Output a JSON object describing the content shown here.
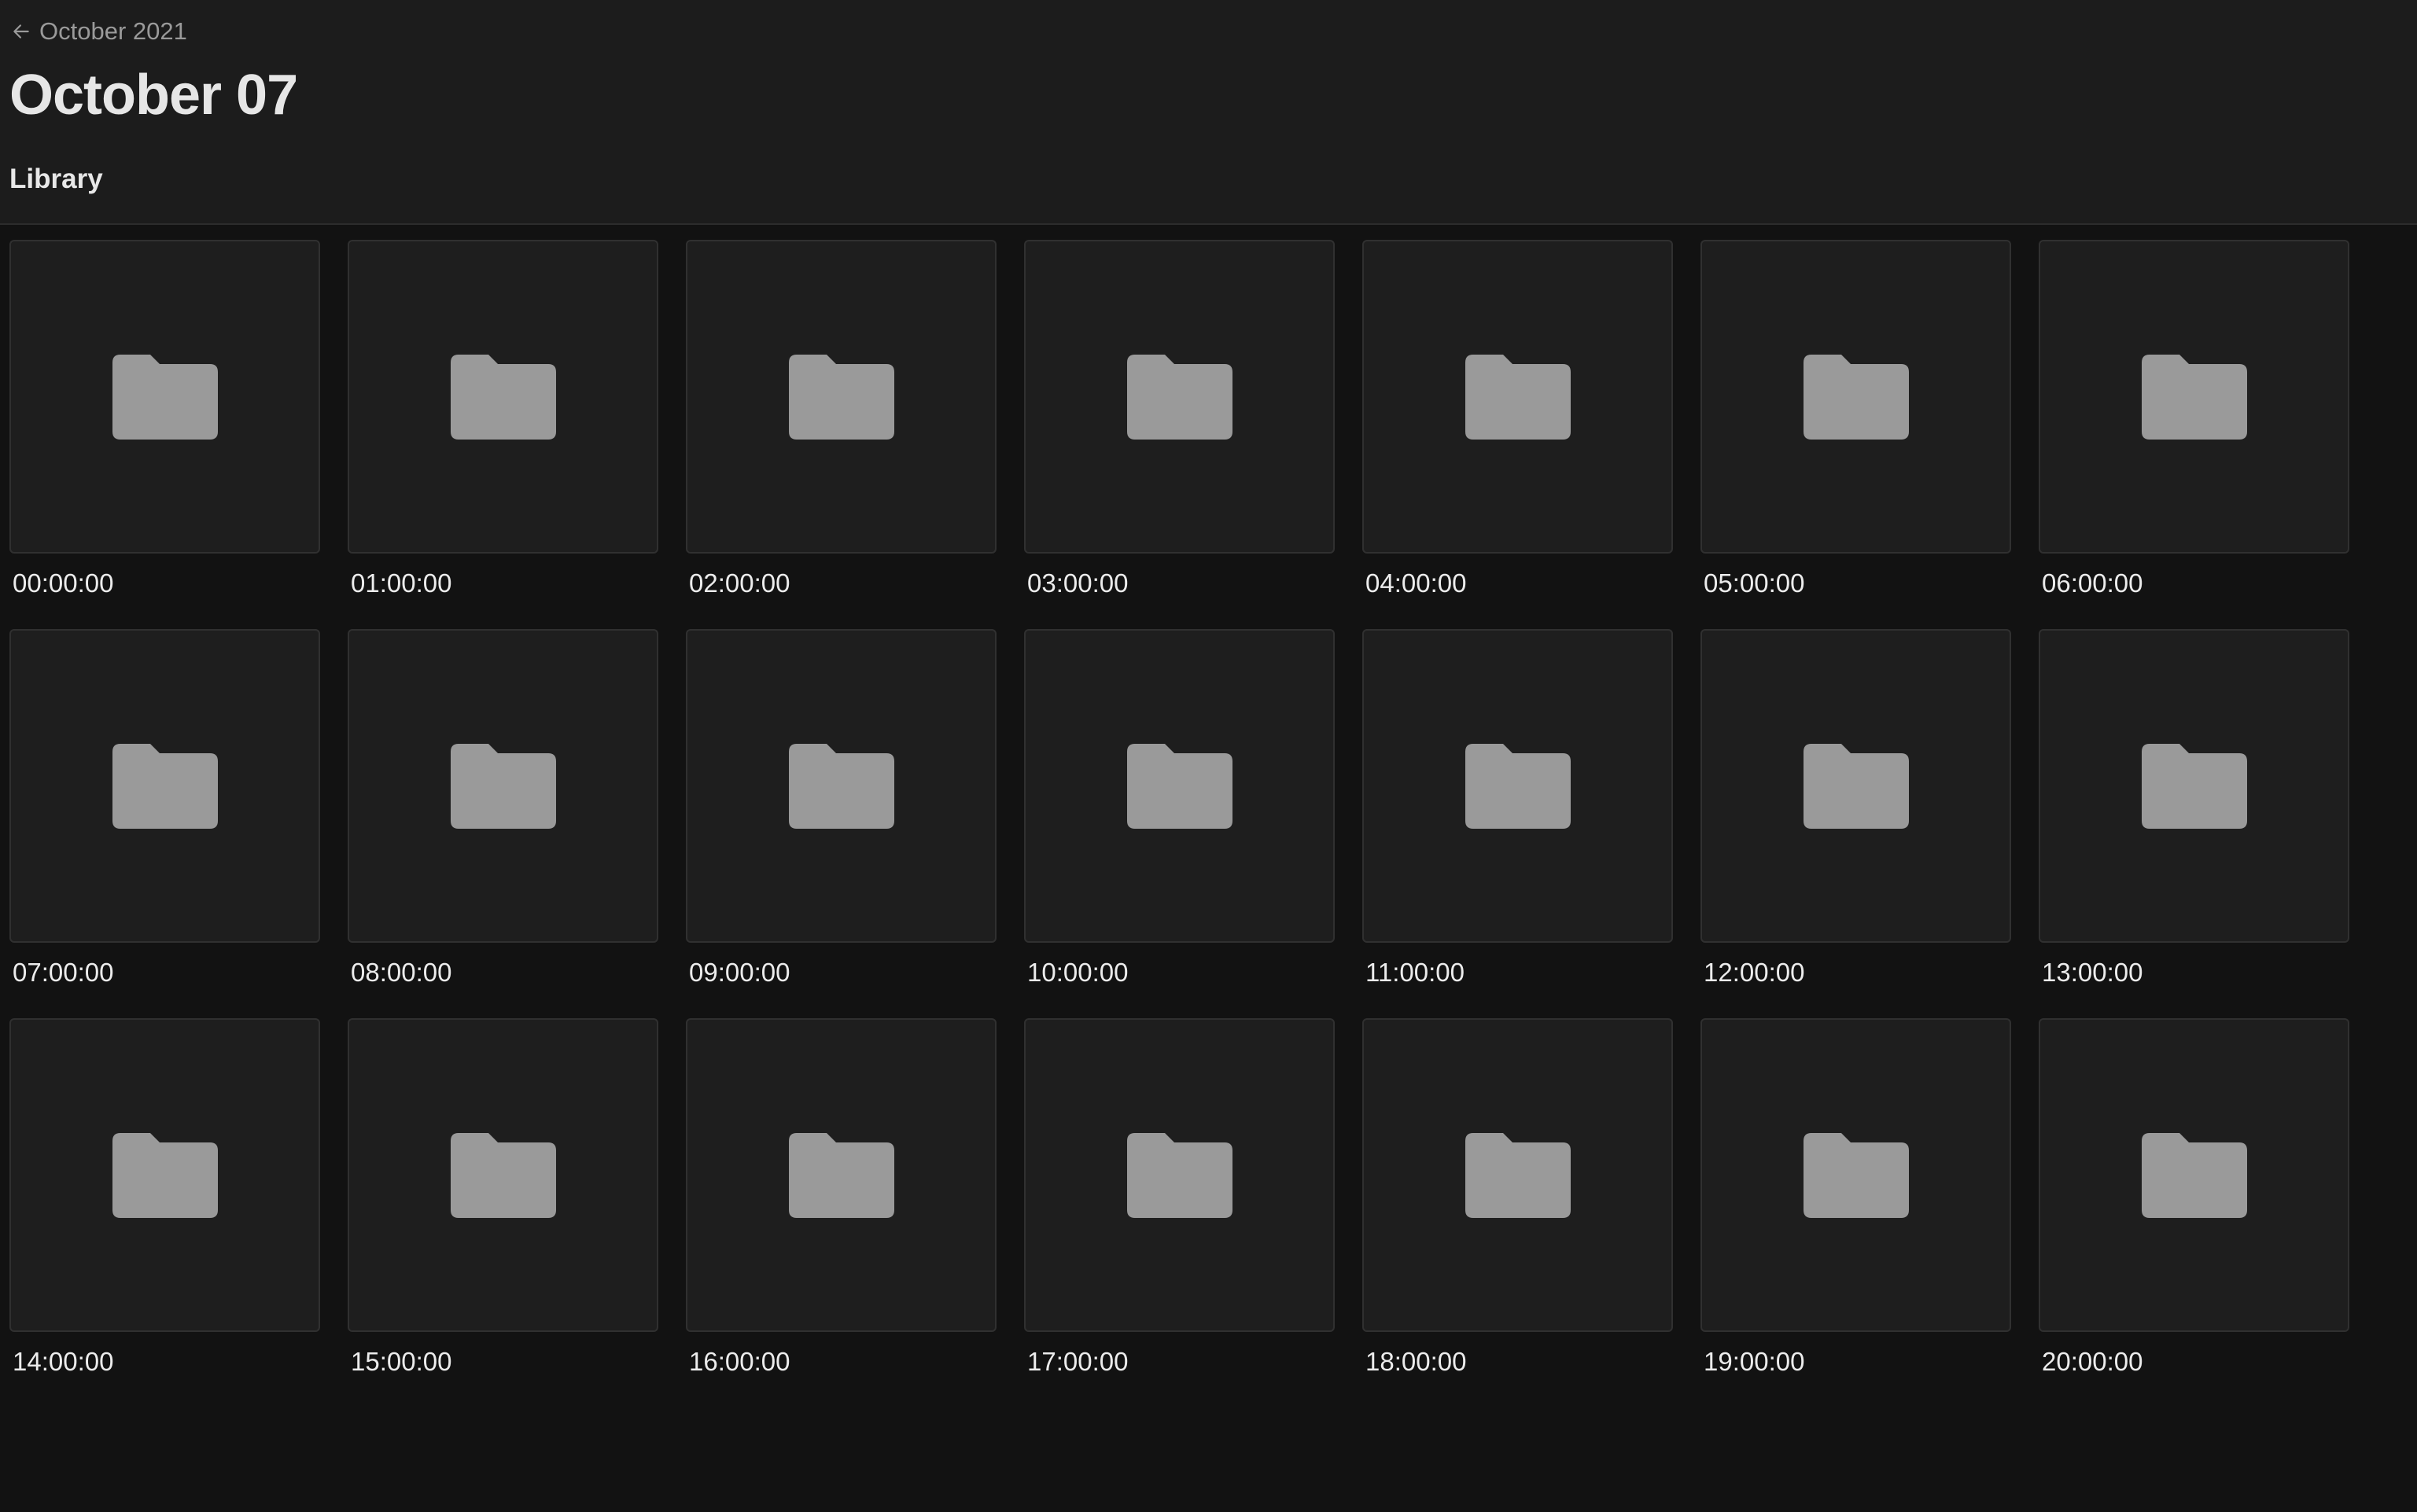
{
  "header": {
    "back_label": "October 2021",
    "title": "October 07",
    "section_tab": "Library"
  },
  "folders": [
    {
      "label": "00:00:00"
    },
    {
      "label": "01:00:00"
    },
    {
      "label": "02:00:00"
    },
    {
      "label": "03:00:00"
    },
    {
      "label": "04:00:00"
    },
    {
      "label": "05:00:00"
    },
    {
      "label": "06:00:00"
    },
    {
      "label": "07:00:00"
    },
    {
      "label": "08:00:00"
    },
    {
      "label": "09:00:00"
    },
    {
      "label": "10:00:00"
    },
    {
      "label": "11:00:00"
    },
    {
      "label": "12:00:00"
    },
    {
      "label": "13:00:00"
    },
    {
      "label": "14:00:00"
    },
    {
      "label": "15:00:00"
    },
    {
      "label": "16:00:00"
    },
    {
      "label": "17:00:00"
    },
    {
      "label": "18:00:00"
    },
    {
      "label": "19:00:00"
    },
    {
      "label": "20:00:00"
    }
  ],
  "icons": {
    "back": "arrow-left-icon",
    "folder": "folder-icon"
  },
  "colors": {
    "background": "#121212",
    "header_background": "#1c1c1c",
    "tile_background": "#1e1e1e",
    "folder_icon": "#9a9a9a",
    "text_primary": "#e6e6e6",
    "text_muted": "#9a9a9a"
  }
}
